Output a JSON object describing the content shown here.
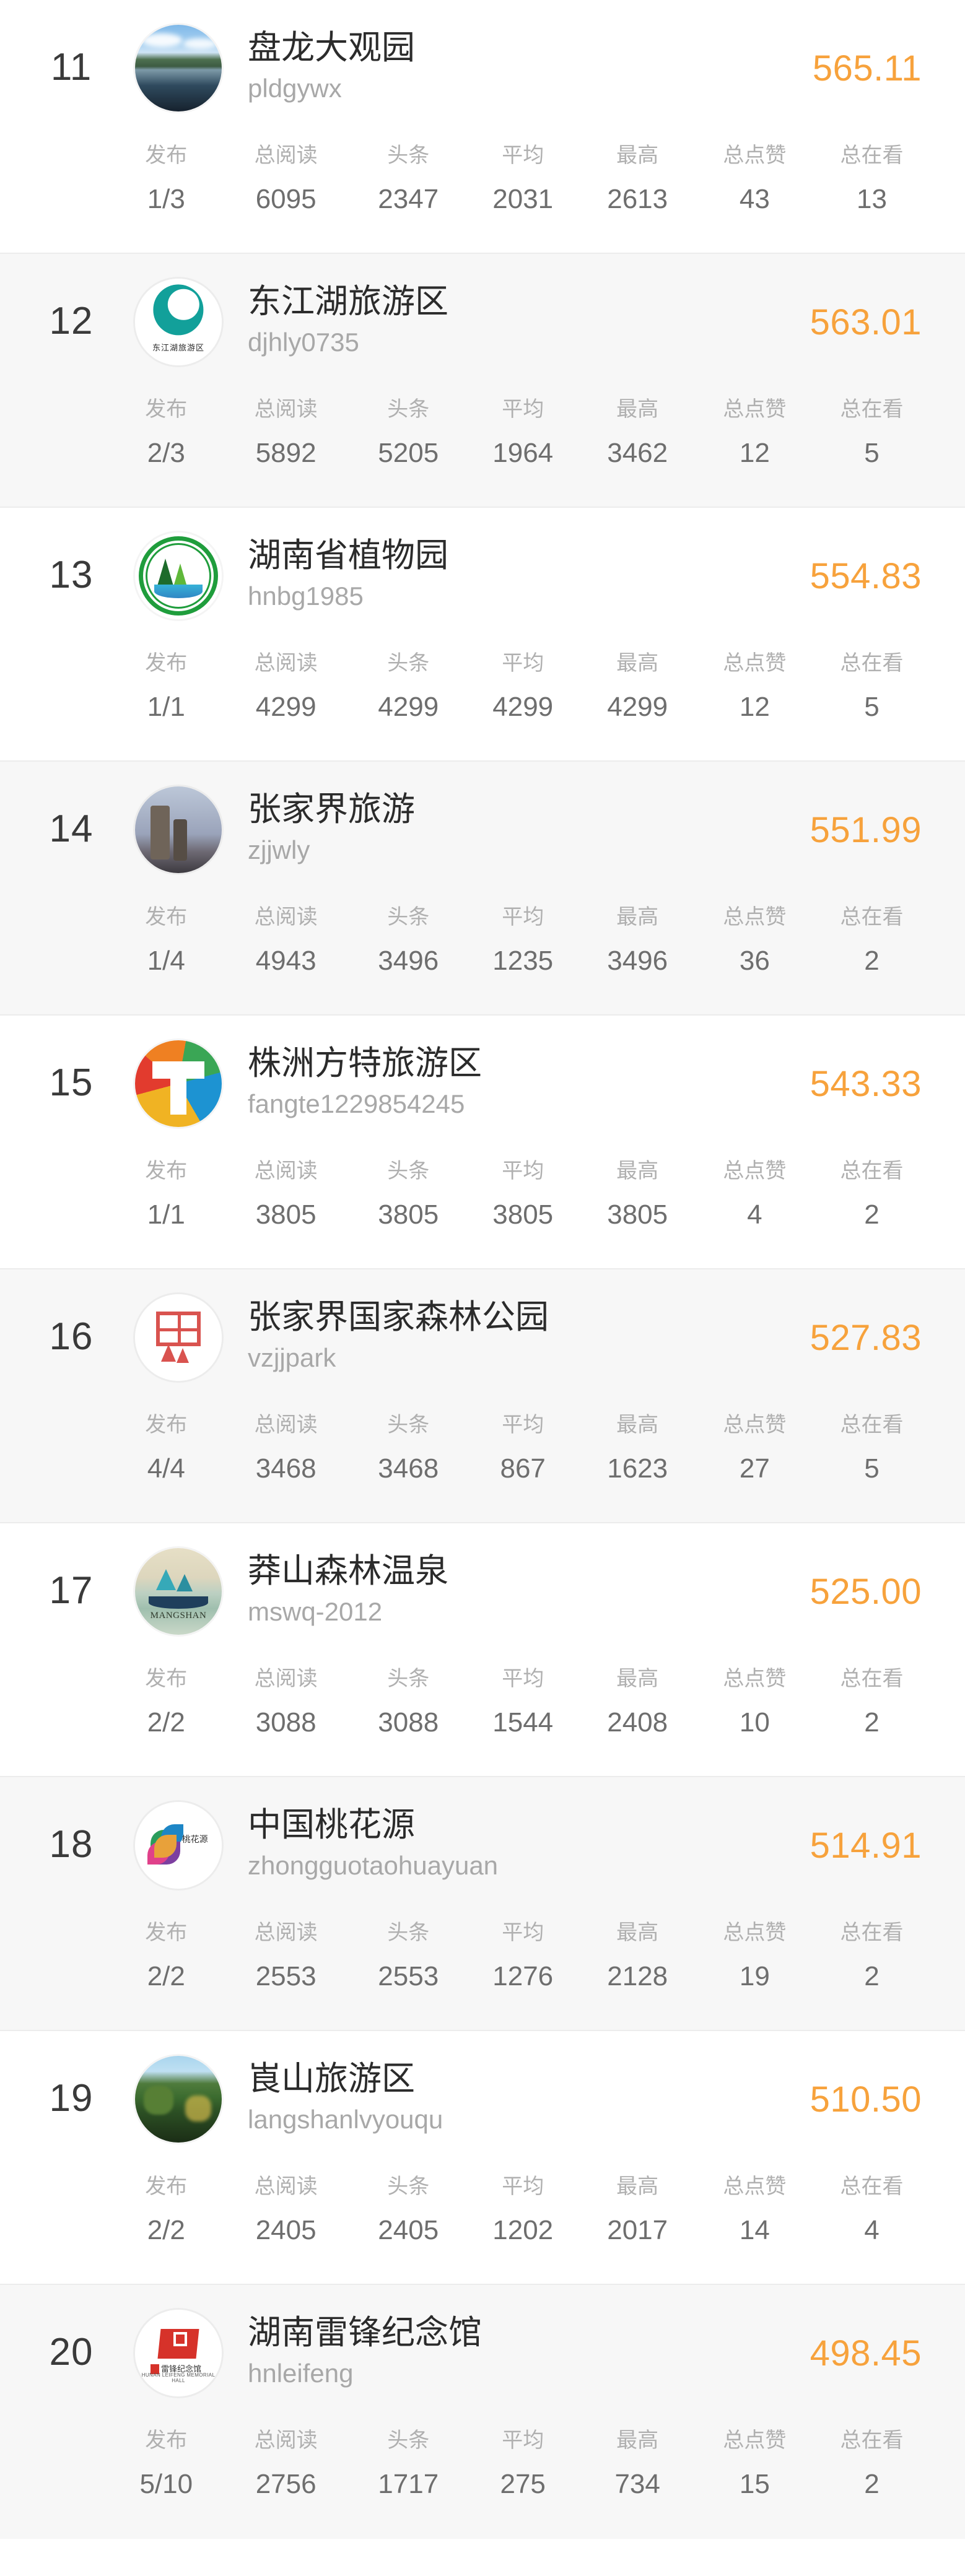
{
  "stat_headers": [
    "发布",
    "总阅读",
    "头条",
    "平均",
    "最高",
    "总点赞",
    "总在看"
  ],
  "colors": {
    "score": "#f7a23c",
    "rank": "#3a3a3a",
    "name": "#2b2b2b",
    "account_id": "#a8a8a8",
    "stat_label": "#b0b0b0",
    "stat_value": "#6e6e6e",
    "row_bg": "#ffffff",
    "row_bg_alt": "#f7f7f7"
  },
  "rows": [
    {
      "rank": "11",
      "name": "盘龙大观园",
      "account_id": "pldgywx",
      "score": "565.11",
      "avatar_icon": "panlong-lake-photo-avatar",
      "stats": [
        "1/3",
        "6095",
        "2347",
        "2031",
        "2613",
        "43",
        "13"
      ]
    },
    {
      "rank": "12",
      "name": "东江湖旅游区",
      "account_id": "djhly0735",
      "score": "563.01",
      "avatar_icon": "dongjianghu-teal-logo-avatar",
      "stats": [
        "2/3",
        "5892",
        "5205",
        "1964",
        "3462",
        "12",
        "5"
      ]
    },
    {
      "rank": "13",
      "name": "湖南省植物园",
      "account_id": "hnbg1985",
      "score": "554.83",
      "avatar_icon": "hunan-botanical-garden-logo-avatar",
      "stats": [
        "1/1",
        "4299",
        "4299",
        "4299",
        "4299",
        "12",
        "5"
      ]
    },
    {
      "rank": "14",
      "name": "张家界旅游",
      "account_id": "zjjwly",
      "score": "551.99",
      "avatar_icon": "zhangjiajie-peaks-photo-avatar",
      "stats": [
        "1/4",
        "4943",
        "3496",
        "1235",
        "3496",
        "36",
        "2"
      ]
    },
    {
      "rank": "15",
      "name": "株洲方特旅游区",
      "account_id": "fangte1229854245",
      "score": "543.33",
      "avatar_icon": "fangte-colorful-t-logo-avatar",
      "stats": [
        "1/1",
        "3805",
        "3805",
        "3805",
        "3805",
        "4",
        "2"
      ]
    },
    {
      "rank": "16",
      "name": "张家界国家森林公园",
      "account_id": "vzjjpark",
      "score": "527.83",
      "avatar_icon": "zhangjiajie-park-red-seal-avatar",
      "stats": [
        "4/4",
        "3468",
        "3468",
        "867",
        "1623",
        "27",
        "5"
      ]
    },
    {
      "rank": "17",
      "name": "莽山森林温泉",
      "account_id": "mswq-2012",
      "score": "525.00",
      "avatar_icon": "mangshan-hot-spring-logo-avatar",
      "avatar_text": "MANGSHAN",
      "stats": [
        "2/2",
        "3088",
        "3088",
        "1544",
        "2408",
        "10",
        "2"
      ]
    },
    {
      "rank": "18",
      "name": "中国桃花源",
      "account_id": "zhongguotaohuayuan",
      "score": "514.91",
      "avatar_icon": "taohuayuan-flower-logo-avatar",
      "avatar_text": "桃花源",
      "stats": [
        "2/2",
        "2553",
        "2553",
        "1276",
        "2128",
        "19",
        "2"
      ]
    },
    {
      "rank": "19",
      "name": "崀山旅游区",
      "account_id": "langshanlvyouqu",
      "score": "510.50",
      "avatar_icon": "langshan-mountain-photo-avatar",
      "stats": [
        "2/2",
        "2405",
        "2405",
        "1202",
        "2017",
        "14",
        "4"
      ]
    },
    {
      "rank": "20",
      "name": "湖南雷锋纪念馆",
      "account_id": "hnleifeng",
      "score": "498.45",
      "avatar_icon": "leifeng-memorial-red-logo-avatar",
      "avatar_text": "雷锋纪念馆",
      "avatar_subtext": "HUNAN LEIFENG MEMORIAL HALL",
      "stats": [
        "5/10",
        "2756",
        "1717",
        "275",
        "734",
        "15",
        "2"
      ]
    }
  ]
}
